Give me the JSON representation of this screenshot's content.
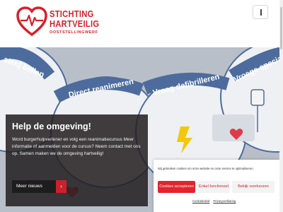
{
  "header": {
    "logo": {
      "line1": "STICHTING",
      "line2": "HARTVEILIG",
      "line3": "OOSTSTELLINGWERF"
    },
    "menu_icon": "menu-icon"
  },
  "hero": {
    "background_texts": [
      "aten) bellen",
      "Direct reanimeren",
      "Vroeg defibrilleren",
      "Vroege speciale"
    ],
    "card": {
      "title": "Help de omgeving!",
      "text": "Word burgerhulpverlener en volg een reanimatiecursus Meer informatie of aanmelden voor de cursus? Neem contact met ons op. Samen maken we de omgeving hartveilig!",
      "button_label": "Meer nieuws",
      "button_icon": "chevron-right-icon"
    }
  },
  "cookie_banner": {
    "text": "Wij gebruiken cookies om onze website en onze service te optimaliseren.",
    "accept_label": "Cookies accepteren",
    "functional_label": "Enkel functioneel",
    "preferences_label": "Bekijk voorkeuren",
    "cookiebeleid_label": "Cookiebeleid",
    "privacy_label": "Privacyverklaring"
  },
  "colors": {
    "brand_red": "#d8202a",
    "card_bg": "#231e20",
    "hero_bg": "#b9bfc9",
    "hero_band": "#4d6c9d"
  }
}
